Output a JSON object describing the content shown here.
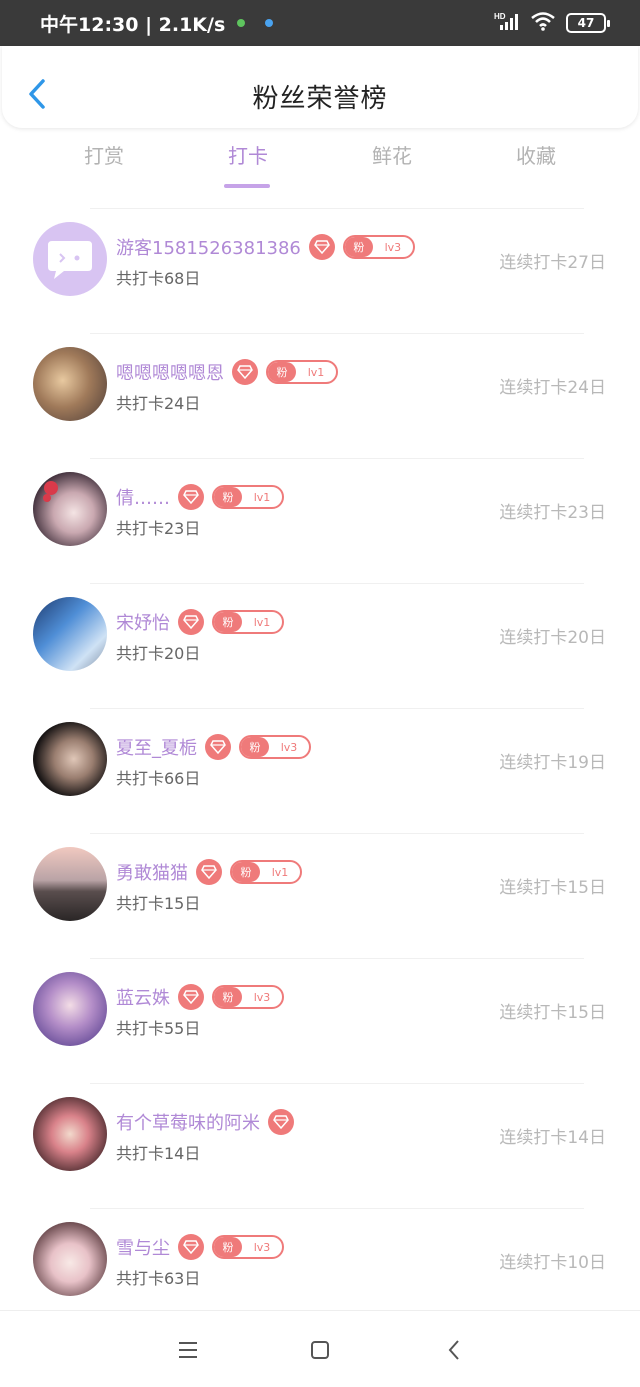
{
  "status_bar": {
    "time_speed": "中午12:30 | 2.1K/s",
    "battery": "47",
    "network": "HD"
  },
  "header": {
    "title": "粉丝荣誉榜"
  },
  "tabs": [
    {
      "label": "打赏"
    },
    {
      "label": "打卡"
    },
    {
      "label": "鲜花"
    },
    {
      "label": "收藏"
    }
  ],
  "active_tab": "打卡",
  "colors": {
    "accent": "#b089d6",
    "badge": "#ef7a7a",
    "muted": "#b8b8b8"
  },
  "fans": [
    {
      "name": "游客1581526381386",
      "total": "共打卡68日",
      "streak": "连续打卡27日",
      "fan_label": "粉",
      "level": "lv3"
    },
    {
      "name": "嗯嗯嗯嗯嗯恩",
      "total": "共打卡24日",
      "streak": "连续打卡24日",
      "fan_label": "粉",
      "level": "lv1"
    },
    {
      "name": "倩……",
      "total": "共打卡23日",
      "streak": "连续打卡23日",
      "fan_label": "粉",
      "level": "lv1"
    },
    {
      "name": "宋妤怡",
      "total": "共打卡20日",
      "streak": "连续打卡20日",
      "fan_label": "粉",
      "level": "lv1"
    },
    {
      "name": "夏至_夏栀",
      "total": "共打卡66日",
      "streak": "连续打卡19日",
      "fan_label": "粉",
      "level": "lv3"
    },
    {
      "name": "勇敢猫猫",
      "total": "共打卡15日",
      "streak": "连续打卡15日",
      "fan_label": "粉",
      "level": "lv1"
    },
    {
      "name": "蓝云姝",
      "total": "共打卡55日",
      "streak": "连续打卡15日",
      "fan_label": "粉",
      "level": "lv3"
    },
    {
      "name": "有个草莓味的阿米",
      "total": "共打卡14日",
      "streak": "连续打卡14日"
    },
    {
      "name": "雪与尘",
      "total": "共打卡63日",
      "streak": "连续打卡10日",
      "fan_label": "粉",
      "level": "lv3"
    }
  ]
}
